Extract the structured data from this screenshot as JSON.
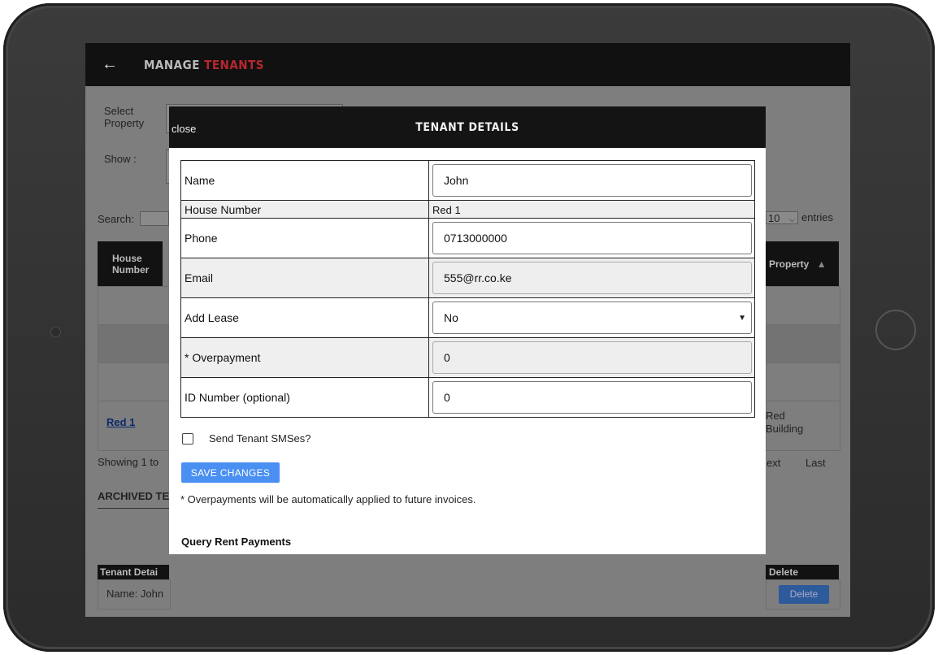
{
  "header": {
    "back_icon": "arrow-left-icon",
    "title_prefix": "MANAGE",
    "title_accent": "TENANTS",
    "accent_color": "#b7272f"
  },
  "background": {
    "select_property_label": "Select Property",
    "show_label": "Show :",
    "search_label": "Search:",
    "entries_value": "10",
    "entries_label": "entries",
    "col_house_number": "House Number",
    "col_property": "Property",
    "row_house_link": "Red 1",
    "row_property": "Red Building",
    "showing_text": "Showing 1 to",
    "pager_next": "ext",
    "pager_last": "Last",
    "archived_heading": "ARCHIVED TE",
    "archived_col_tenant": "Tenant Detai",
    "archived_col_delete": "Delete",
    "archived_row_name": "Name: John",
    "delete_button": "Delete"
  },
  "modal": {
    "close_label": "close",
    "title": "TENANT DETAILS",
    "fields": {
      "name": {
        "label": "Name",
        "value": "John"
      },
      "house_number": {
        "label": "House Number",
        "value": "Red 1"
      },
      "phone": {
        "label": "Phone",
        "value": "0713000000"
      },
      "email": {
        "label": "Email",
        "value": "555@rr.co.ke"
      },
      "add_lease": {
        "label": "Add Lease",
        "value": "No"
      },
      "overpayment": {
        "label": "* Overpayment",
        "value": "0"
      },
      "id_number": {
        "label": "ID Number (optional)",
        "value": "0"
      }
    },
    "sms_checkbox_label": "Send Tenant SMSes?",
    "sms_checked": false,
    "save_button": "SAVE CHANGES",
    "save_button_color": "#4a8ff2",
    "note": "* Overpayments will be automatically applied to future invoices.",
    "query_heading": "Query Rent Payments"
  }
}
